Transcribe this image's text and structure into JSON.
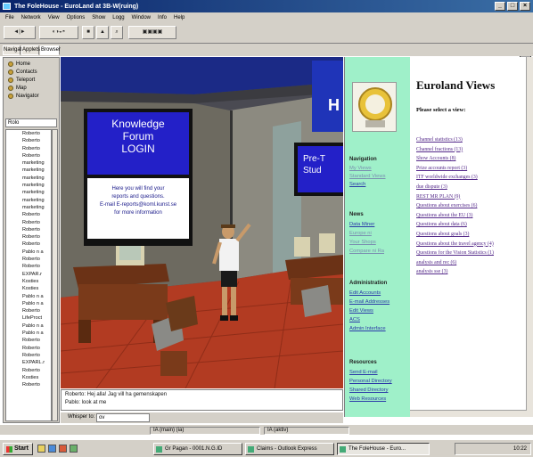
{
  "window": {
    "title": "The FoleHouse - EuroLand at 3B-W(ruing)"
  },
  "menu": [
    "File",
    "Network",
    "View",
    "Options",
    "Show",
    "Logg",
    "Window",
    "Info",
    "Help"
  ],
  "tabs": [
    "Navigator",
    "Applets",
    "Browser"
  ],
  "left_nav": [
    "Home",
    "Contacts",
    "Teleport",
    "Map",
    "Navigator"
  ],
  "left_select": "Rolo",
  "left_list": [
    "Roberto",
    "Roberto",
    "Roberto",
    "Roberto",
    "marketing",
    "marketing",
    "marketing",
    "marketing",
    "marketing",
    "marketing",
    "marketing",
    "Roberto",
    "Roberto",
    "Roberto",
    "Roberto",
    "Roberto",
    "Pablo n a",
    "Roberto",
    "Roberto",
    "EXPAR.r",
    "Kosties",
    "Kosties",
    "Pablo n a",
    "Pablo n a",
    "Roberto",
    "LifeProct",
    "Pablo n a",
    "Pablo n a",
    "Roberto",
    "Roberto",
    "Roberto",
    "EXPARL.r",
    "Roberto",
    "Kosties",
    "Roberto"
  ],
  "scene": {
    "sign1_lines": [
      "Knowledge",
      "Forum",
      "LOGIN"
    ],
    "sign1_sub": [
      "Here you will find your",
      "reports and questions.",
      "E-mail E-reports@koml.kunst.se",
      "for more information"
    ],
    "sign2_lines": [
      "Pre-T",
      "Stud"
    ],
    "sign3_line": "H"
  },
  "chat": {
    "lines": [
      "Roberto:   Hej alla! Jag vill ha gemenskapen",
      "Pablo:      look at me"
    ],
    "input_label": "Whisper to:",
    "input_value": "ov"
  },
  "right_nav": {
    "nav_heading": "Navigation",
    "nav_links": [
      "My Views",
      "Standard Views",
      "Search"
    ],
    "news_heading": "News",
    "news_links": [
      "Data Miner",
      "Europe ni",
      "Your Shops",
      "Compare ni Ra"
    ],
    "admin_heading": "Administration",
    "admin_links": [
      "Edit Accounts",
      "E-mail Addresses",
      "Edit Views",
      "ACS",
      "Admin Interface"
    ],
    "res_heading": "Resources",
    "res_links": [
      "Send E-mail",
      "Personal Directory",
      "Shared Directory",
      "Web Resources"
    ]
  },
  "content": {
    "title": "Euroland Views",
    "subtitle": "Please select a view:",
    "views": [
      "Channel statistics (13)",
      "Channel fractions (13)",
      "Show Accounts (8)",
      "Prize accounts report (3)",
      "ITF worldwide exchanges (3)",
      "due dispute (3)",
      "REST MR PLAN (9)",
      "Questions about exercises (6)",
      "Questions about the EU (3)",
      "Questions about data (6)",
      "Questions about goals (3)",
      "Questions about the travel agency (4)",
      "Questions for the Vision Statistics (1)",
      "analysis and rec (6)",
      "analysis sse (3)"
    ]
  },
  "status": {
    "cell1": "IA (main) (ia)",
    "cell2": "IA (aktiv)"
  },
  "taskbar": {
    "start": "Start",
    "tasks": [
      "Gr Pagan - 0001.N.G.ID",
      "Claims - Outlook Express",
      "The FoleHouse - Euro..."
    ],
    "clock": "10:22"
  }
}
